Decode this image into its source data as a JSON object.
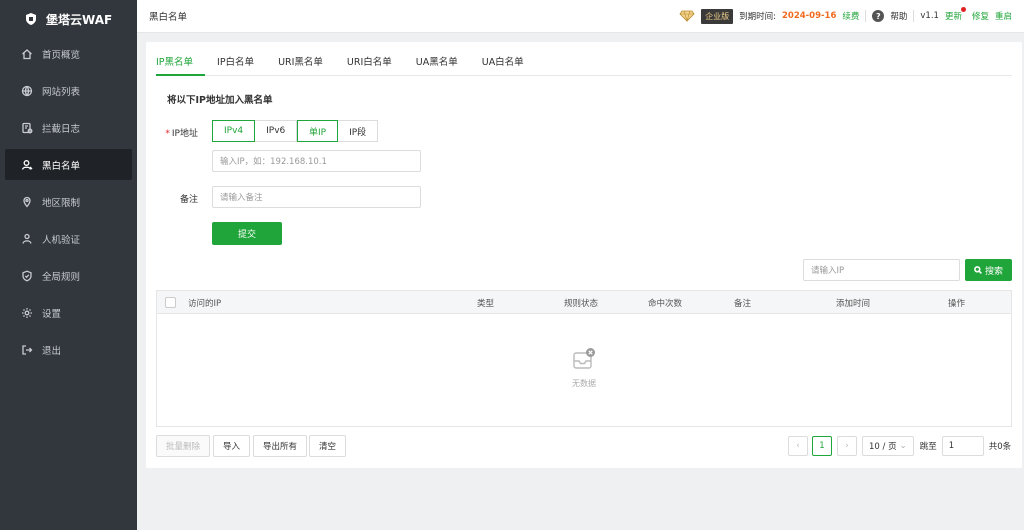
{
  "app": {
    "name": "堡塔云WAF"
  },
  "sidebar": {
    "items": [
      {
        "label": "首页概览",
        "icon": "home-icon"
      },
      {
        "label": "网站列表",
        "icon": "globe-icon"
      },
      {
        "label": "拦截日志",
        "icon": "log-icon"
      },
      {
        "label": "黑白名单",
        "icon": "user-icon",
        "active": true
      },
      {
        "label": "地区限制",
        "icon": "map-icon"
      },
      {
        "label": "人机验证",
        "icon": "person-verify-icon"
      },
      {
        "label": "全局规则",
        "icon": "shield-icon"
      },
      {
        "label": "设置",
        "icon": "gear-icon"
      },
      {
        "label": "退出",
        "icon": "logout-icon"
      }
    ]
  },
  "header": {
    "title": "黑白名单",
    "edition": "企业版",
    "expire_label": "到期时间:",
    "expire_date": "2024-09-16",
    "renew": "续费",
    "help": "帮助",
    "version": "v1.1",
    "update": "更新",
    "repair": "修复",
    "restart": "重启"
  },
  "tabs": [
    "IP黑名单",
    "IP白名单",
    "URI黑名单",
    "URI白名单",
    "UA黑名单",
    "UA白名单"
  ],
  "form": {
    "section_title": "将以下IP地址加入黑名单",
    "ip_label": "IP地址",
    "ip_versions": [
      "IPv4",
      "IPv6"
    ],
    "ip_modes": [
      "单IP",
      "IP段"
    ],
    "ip_placeholder": "输入IP，如：192.168.10.1",
    "note_label": "备注",
    "note_placeholder": "请输入备注",
    "submit": "提交"
  },
  "search": {
    "placeholder": "请输入IP",
    "button": "搜索"
  },
  "table": {
    "columns": [
      "访问的IP",
      "类型",
      "规则状态",
      "命中次数",
      "备注",
      "添加时间",
      "操作"
    ],
    "empty_text": "无数据"
  },
  "footer": {
    "batch_delete": "批量删除",
    "import": "导入",
    "export_all": "导出所有",
    "clear": "清空",
    "current_page": "1",
    "page_size": "10 / 页",
    "jump_label": "跳至",
    "jump_value": "1",
    "total": "共0条"
  },
  "colors": {
    "accent": "#20a53a",
    "sidebar": "#32373e",
    "expire": "#f06b1f"
  }
}
